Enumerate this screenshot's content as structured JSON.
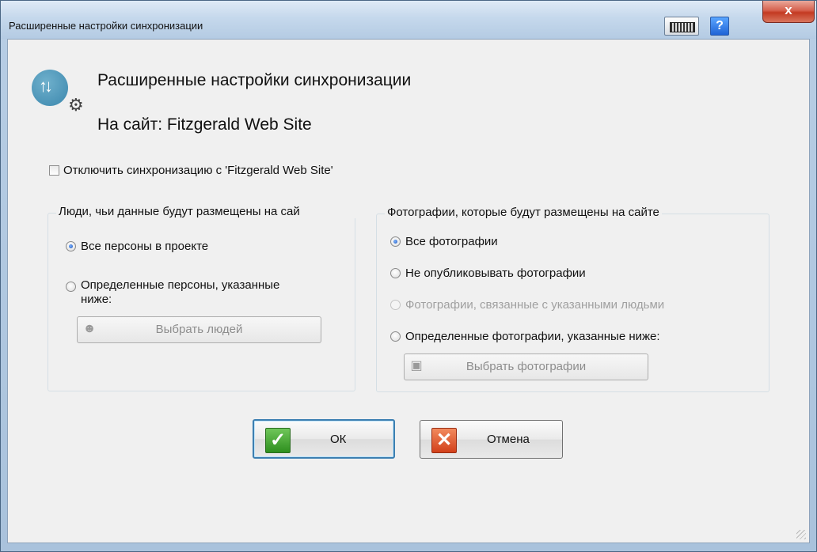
{
  "window": {
    "title": "Расширенные настройки синхронизации",
    "help_label": "?",
    "close_label": "x"
  },
  "header": {
    "title": "Расширенные настройки синхронизации",
    "subtitle": "На сайт: Fitzgerald Web Site"
  },
  "disable_sync": {
    "label": "Отключить синхронизацию с 'Fitzgerald Web Site'",
    "checked": false
  },
  "people_group": {
    "legend": "Люди, чьи данные будут размещены на сай",
    "options": [
      {
        "label": "Все персоны в проекте",
        "checked": true,
        "enabled": true
      },
      {
        "label_line1": "Определенные персоны, указанные",
        "label_line2": "ниже:",
        "checked": false,
        "enabled": true
      }
    ],
    "pick_button": "Выбрать людей"
  },
  "photos_group": {
    "legend": "Фотографии, которые будут размещены на сайте",
    "options": [
      {
        "label": "Все фотографии",
        "checked": true,
        "enabled": true
      },
      {
        "label": "Не опубликовывать фотографии",
        "checked": false,
        "enabled": true
      },
      {
        "label": "Фотографии, связанные с указанными людьми",
        "checked": false,
        "enabled": false
      },
      {
        "label": "Определенные фотографии, указанные ниже:",
        "checked": false,
        "enabled": true
      }
    ],
    "pick_button": "Выбрать фотографии"
  },
  "buttons": {
    "ok": "ОК",
    "cancel": "Отмена"
  },
  "colors": {
    "accent": "#3c7fb1",
    "ok_icon": "#2e8f1e",
    "cancel_icon": "#d2401a",
    "close_button": "#c33a22"
  },
  "icons": {
    "app": "sync-settings-icon",
    "keyboard": "keyboard-icon",
    "help": "help-icon",
    "close": "close-icon",
    "people": "person-icon",
    "photos": "photo-icon",
    "ok": "checkmark-icon",
    "cancel": "cross-icon"
  }
}
